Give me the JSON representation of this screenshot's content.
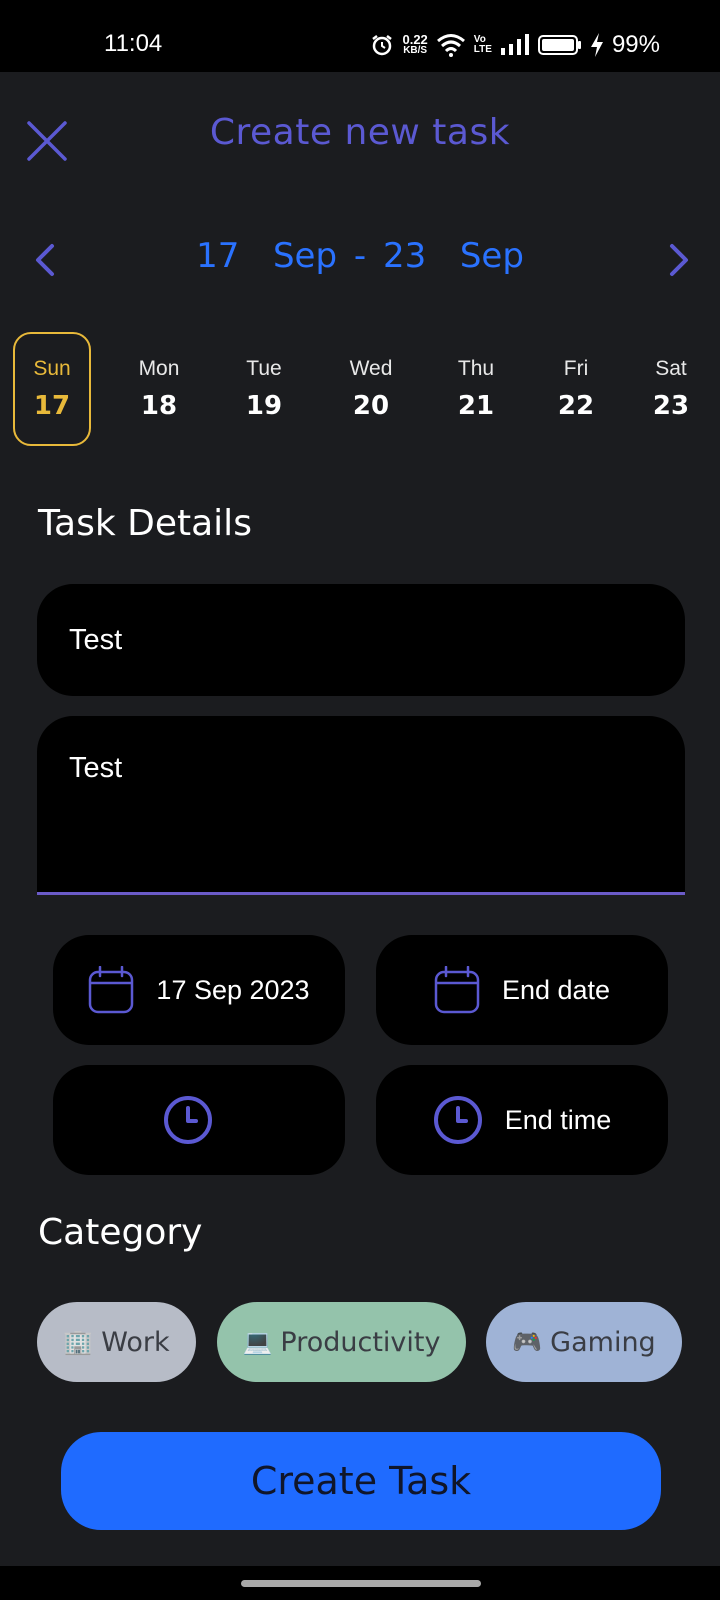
{
  "status": {
    "time": "11:04",
    "net_speed": "0.22",
    "net_unit": "KB/S",
    "volte_top": "Vo",
    "volte_bottom": "LTE",
    "battery": "99%"
  },
  "header": {
    "title": "Create new task"
  },
  "week": {
    "range": "17  Sep - 23  Sep",
    "days": [
      {
        "name": "Sun",
        "num": "17",
        "selected": true
      },
      {
        "name": "Mon",
        "num": "18"
      },
      {
        "name": "Tue",
        "num": "19"
      },
      {
        "name": "Wed",
        "num": "20"
      },
      {
        "name": "Thu",
        "num": "21"
      },
      {
        "name": "Fri",
        "num": "22"
      },
      {
        "name": "Sat",
        "num": "23"
      }
    ]
  },
  "task": {
    "section_title": "Task Details",
    "title_value": "Test",
    "description_value": "Test",
    "start_date": "17 Sep 2023",
    "end_date": "End date",
    "start_time": "",
    "end_time": "End time"
  },
  "category": {
    "section_title": "Category",
    "items": [
      {
        "emoji": "🏢",
        "label": "Work",
        "color": "#b7bcc7"
      },
      {
        "emoji": "💻",
        "label": "Productivity",
        "color": "#94c3ab"
      },
      {
        "emoji": "🎮",
        "label": "Gaming",
        "color": "#9fb3d6"
      }
    ]
  },
  "actions": {
    "create_label": "Create Task"
  },
  "colors": {
    "accent": "#5b59d2",
    "date_blue": "#2a72ff",
    "selected_day": "#e8b93a",
    "button": "#1f6bff"
  }
}
